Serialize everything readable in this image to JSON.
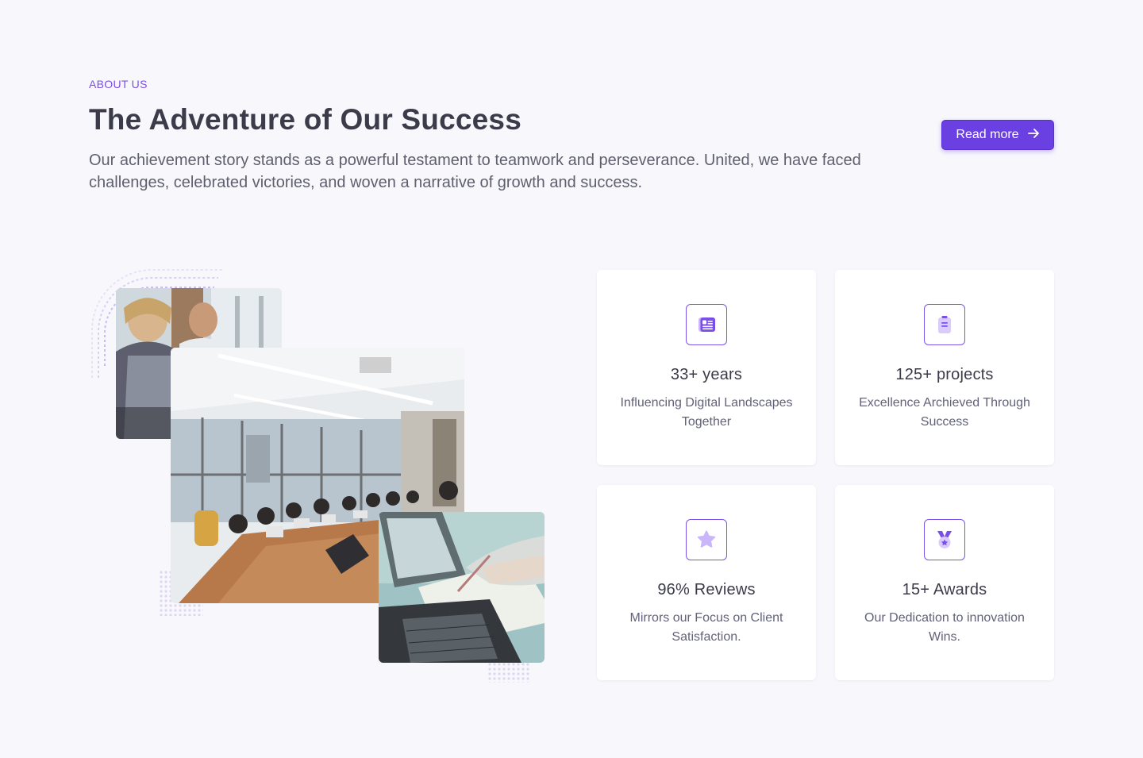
{
  "about": {
    "eyebrow": "ABOUT US",
    "title": "The Adventure of Our Success",
    "description": "Our achievement story stands as a powerful testament to teamwork and perseverance. United, we have faced challenges, celebrated victories, and woven a narrative of growth and success.",
    "read_more_label": "Read more"
  },
  "colors": {
    "accent": "#6b40e3",
    "background": "#f7f7fc",
    "card": "#ffffff"
  },
  "stats": [
    {
      "icon": "newspaper-icon",
      "value": "33+ years",
      "label": "Influencing Digital Landscapes Together"
    },
    {
      "icon": "clipboard-icon",
      "value": "125+ projects",
      "label": "Excellence Archieved Through Success"
    },
    {
      "icon": "star-icon",
      "value": "96% Reviews",
      "label": "Mirrors our Focus on Client Satisfaction."
    },
    {
      "icon": "medal-icon",
      "value": "15+ Awards",
      "label": "Our Dedication to innovation Wins."
    }
  ]
}
